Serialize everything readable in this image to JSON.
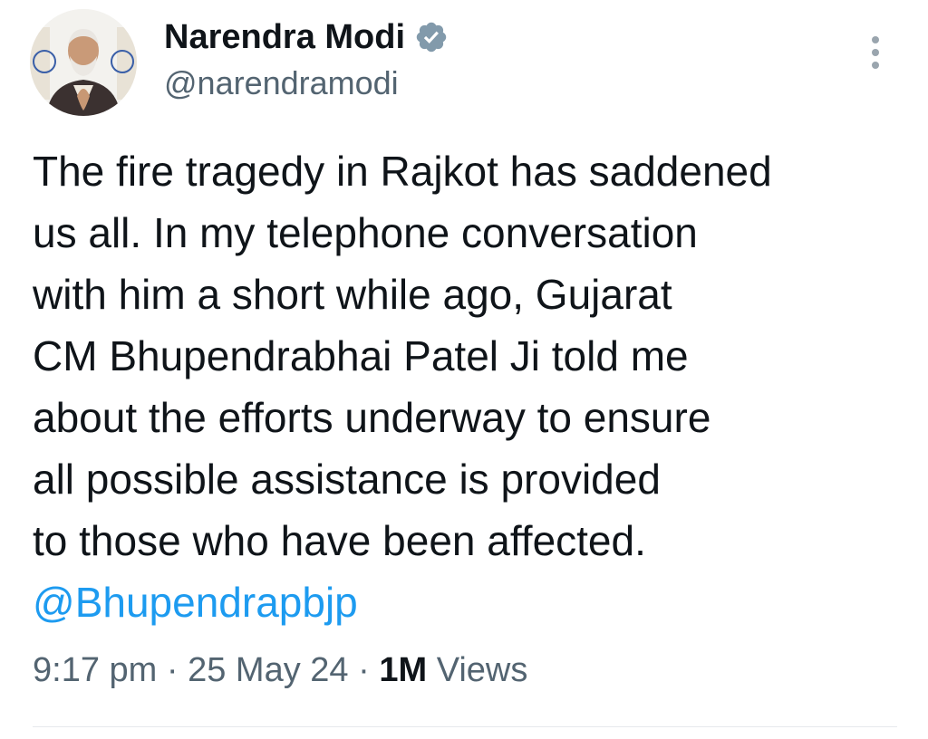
{
  "author": {
    "display_name": "Narendra Modi",
    "handle": "@narendramodi",
    "verified_icon": "verified-badge-icon",
    "avatar": "profile-photo"
  },
  "menu_icon": "more-vertical-icon",
  "tweet": {
    "lines": [
      "The fire tragedy in Rajkot has saddened",
      "us all. In my telephone conversation",
      "with him a short while ago, Gujarat",
      "CM Bhupendrabhai Patel Ji told me",
      "about the efforts underway to ensure",
      "all possible assistance is provided",
      "to those who have been affected."
    ],
    "mention": "@Bhupendrapbjp"
  },
  "meta": {
    "time": "9:17 pm",
    "separator": "·",
    "date": "25 May 24",
    "views_count": "1M",
    "views_label": "Views"
  },
  "colors": {
    "text": "#0f1419",
    "secondary": "#536471",
    "link": "#1d9bf0",
    "divider": "#e6e9ec"
  }
}
